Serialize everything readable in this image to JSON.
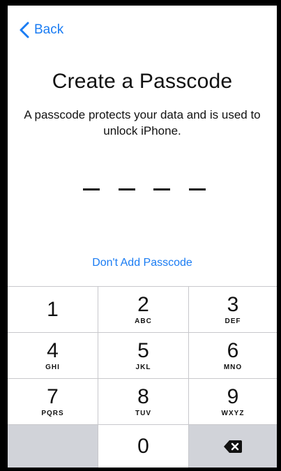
{
  "nav": {
    "back_label": "Back"
  },
  "header": {
    "title": "Create a Passcode",
    "subtitle": "A passcode protects your data and is used to unlock iPhone."
  },
  "passcode": {
    "length": 4,
    "entered": 0
  },
  "skip_link": "Don't Add Passcode",
  "keypad": {
    "keys": [
      {
        "num": "1",
        "letters": ""
      },
      {
        "num": "2",
        "letters": "ABC"
      },
      {
        "num": "3",
        "letters": "DEF"
      },
      {
        "num": "4",
        "letters": "GHI"
      },
      {
        "num": "5",
        "letters": "JKL"
      },
      {
        "num": "6",
        "letters": "MNO"
      },
      {
        "num": "7",
        "letters": "PQRS"
      },
      {
        "num": "8",
        "letters": "TUV"
      },
      {
        "num": "9",
        "letters": "WXYZ"
      },
      {
        "num": "0",
        "letters": ""
      }
    ],
    "delete_icon": "delete-backspace-icon"
  },
  "colors": {
    "accent": "#1a7cf3",
    "keypad_dark": "#d1d3d9"
  }
}
